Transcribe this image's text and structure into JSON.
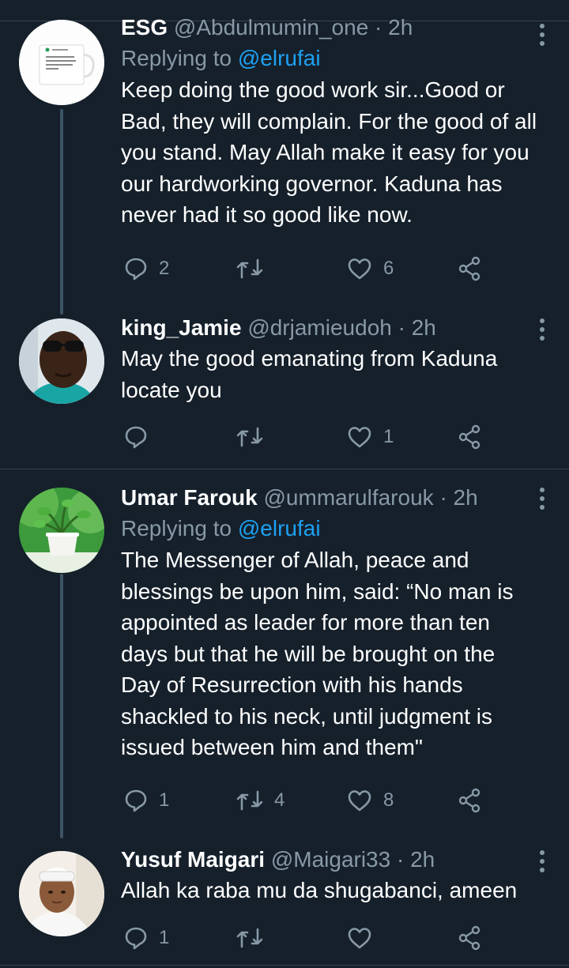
{
  "colors": {
    "background": "#15202b",
    "text": "#ffffff",
    "muted": "#8899a6",
    "link": "#1da1f2",
    "divider": "#38444d"
  },
  "icons": {
    "reply": "reply-icon",
    "retweet": "retweet-icon",
    "like": "heart-icon",
    "share": "share-icon",
    "more": "more-vertical-icon"
  },
  "tweets": [
    {
      "name": "ESG",
      "handle": "@Abdulmumin_one",
      "time": "2h",
      "replying_label": "Replying to",
      "replying_to": "@elrufai",
      "text": "Keep doing the good work sir...Good or Bad, they will complain. For the good of all you stand. May Allah make it easy for you our hardworking governor. Kaduna has never had it so good like now.",
      "reply_count": "2",
      "retweet_count": "",
      "like_count": "6"
    },
    {
      "name": "king_Jamie",
      "handle": "@drjamieudoh",
      "time": "2h",
      "text": "May the good emanating from Kaduna locate you",
      "reply_count": "",
      "retweet_count": "",
      "like_count": "1"
    },
    {
      "name": "Umar Farouk",
      "handle": "@ummarulfarouk",
      "time": "2h",
      "replying_label": "Replying to",
      "replying_to": "@elrufai",
      "text": "The Messenger of Allah, peace and blessings be upon him, said: “No man is appointed as leader for more than ten days but that he will be brought on the Day of Resurrection with his hands shackled to his neck, until judgment is issued between him and them\"",
      "reply_count": "1",
      "retweet_count": "4",
      "like_count": "8"
    },
    {
      "name": "Yusuf Maigari",
      "handle": "@Maigari33",
      "time": "2h",
      "text": "Allah ka raba mu da shugabanci, ameen",
      "reply_count": "1",
      "retweet_count": "",
      "like_count": ""
    }
  ],
  "separator": "·"
}
